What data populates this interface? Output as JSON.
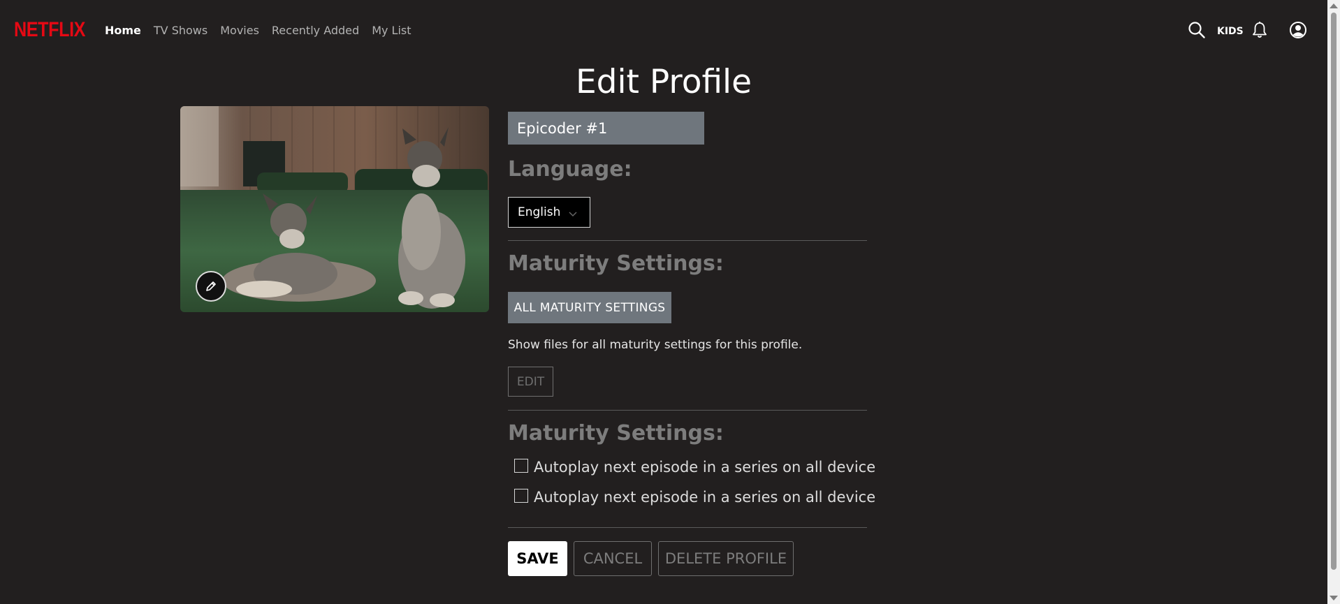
{
  "brand": {
    "logo_text": "NETFLIX",
    "color": "#e50914"
  },
  "nav": {
    "links": [
      {
        "label": "Home",
        "active": true
      },
      {
        "label": "TV Shows",
        "active": false
      },
      {
        "label": "Movies",
        "active": false
      },
      {
        "label": "Recently Added",
        "active": false
      },
      {
        "label": "My List",
        "active": false
      }
    ],
    "kids_label": "KIDS",
    "icons": [
      "search-icon",
      "bell-icon",
      "user-circle-icon"
    ]
  },
  "page": {
    "title": "Edit Profile"
  },
  "profile": {
    "name_value": "Epicoder #1",
    "avatar_icon": "pencil-icon"
  },
  "language": {
    "label": "Language:",
    "selected": "English"
  },
  "maturity": {
    "label": "Maturity Settings:",
    "button_label": "ALL MATURITY SETTINGS",
    "description": "Show files for all maturity settings for this profile.",
    "edit_label": "EDIT"
  },
  "autoplay": {
    "label": "Maturity Settings:",
    "options": [
      {
        "label": "Autoplay next episode in a series on all device",
        "checked": false
      },
      {
        "label": "Autoplay next episode in a series on all device",
        "checked": false
      }
    ]
  },
  "actions": {
    "save_label": "SAVE",
    "cancel_label": "CANCEL",
    "delete_label": "DELETE PROFILE"
  },
  "colors": {
    "background": "#221f1f",
    "input_bg": "#6f767d",
    "muted_text": "#7d7d7d"
  }
}
